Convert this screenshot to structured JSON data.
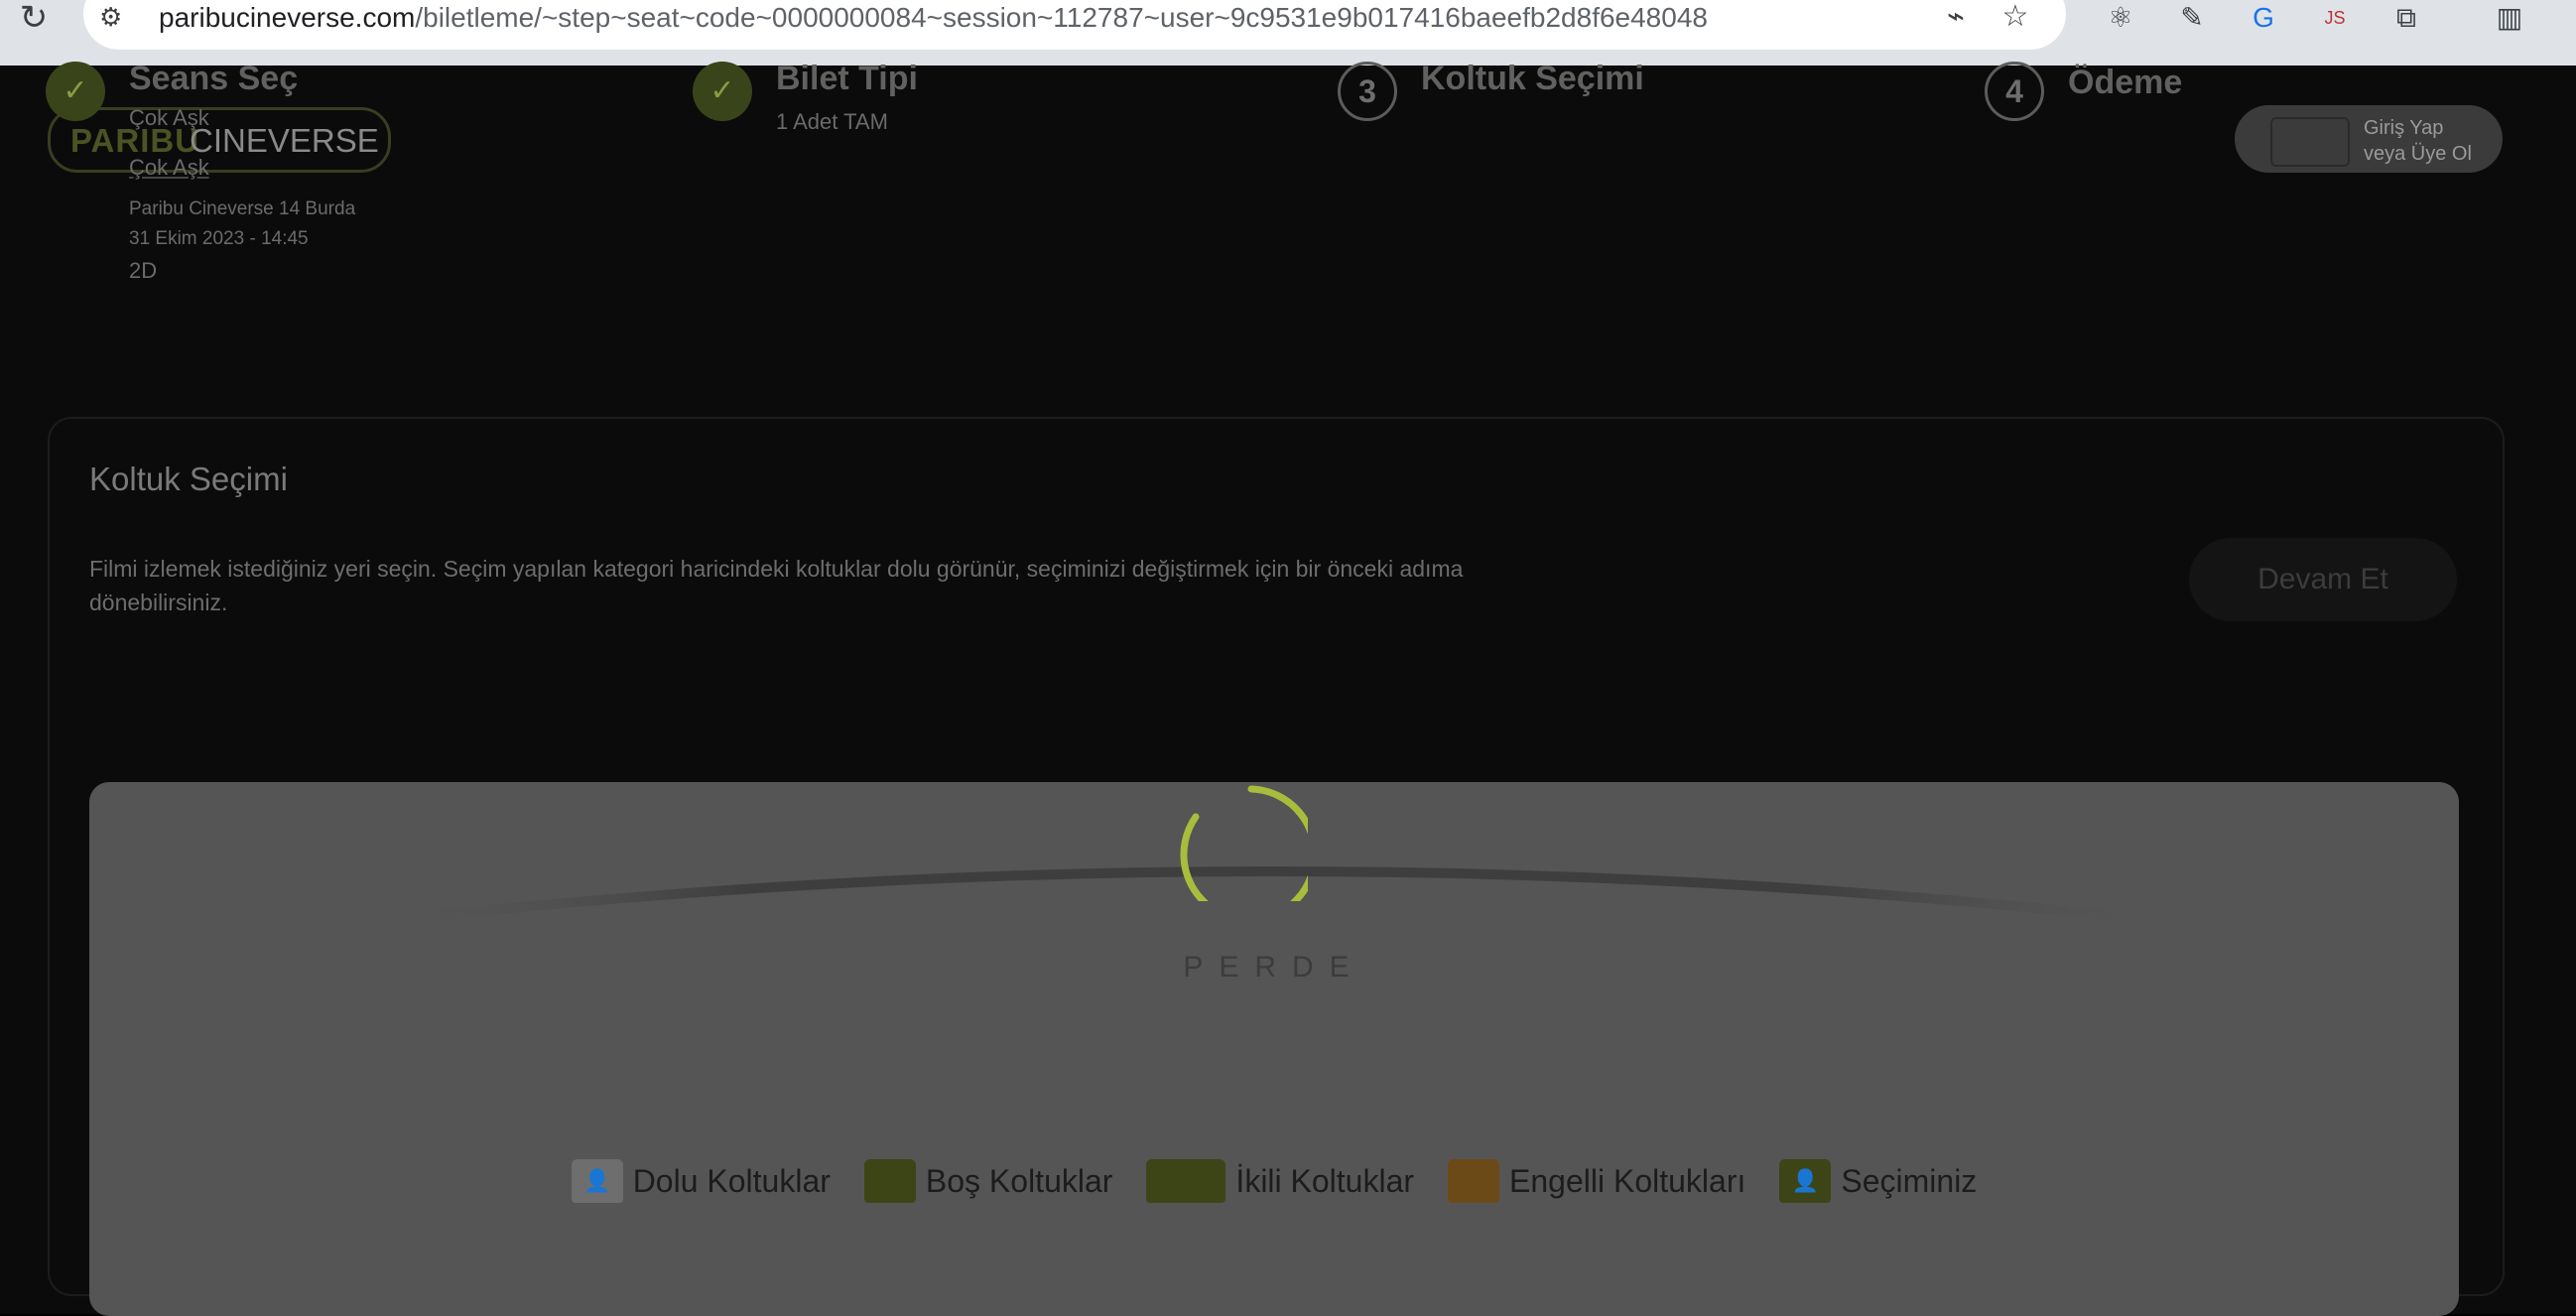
{
  "browser": {
    "url_domain": "paribucineverse.com",
    "url_path": "/biletleme/~step~seat~code~0000000084~session~112787~user~9c9531e9b017416baeefb2d8f6e48048",
    "extensions": [
      "react-devtools-icon",
      "eyedropper-icon",
      "translate-icon",
      "js-icon",
      "puzzle-icon",
      "sidebar-icon"
    ]
  },
  "header": {
    "logo_part1": "PARIBU",
    "logo_part2": "CINEVERSE",
    "login_line1": "Giriş Yap",
    "login_line2": "veya Üye Ol"
  },
  "steps": [
    {
      "number": "1",
      "title": "Seans Seç",
      "subtitle": "Çok Aşk",
      "done": true
    },
    {
      "number": "2",
      "title": "Bilet Tipi",
      "subtitle": "1 Adet TAM",
      "done": true
    },
    {
      "number": "3",
      "title": "Koltuk Seçimi",
      "subtitle": "",
      "done": false
    },
    {
      "number": "4",
      "title": "Ödeme",
      "subtitle": "",
      "done": false
    }
  ],
  "session": {
    "movie": "Çok Aşk",
    "cinema": "Paribu Cineverse 14 Burda",
    "datetime": "31 Ekim 2023 - 14:45",
    "format": "2D"
  },
  "seat_selection": {
    "title": "Koltuk Seçimi",
    "description": "Filmi izlemek istediğiniz yeri seçin. Seçim yapılan kategori haricindeki koltuklar dolu görünür, seçiminizi değiştirmek için bir önceki adıma dönebilirsiniz.",
    "continue_label": "Devam Et",
    "screen_label": "PERDE"
  },
  "legend": [
    {
      "label": "Dolu Koltuklar",
      "color": "#6e6e6e",
      "icon": "person"
    },
    {
      "label": "Boş Koltuklar",
      "color": "#3d4517",
      "icon": ""
    },
    {
      "label": "İkili Koltuklar",
      "color": "#3d4517",
      "icon": "",
      "wide": true
    },
    {
      "label": "Engelli Koltukları",
      "color": "#6b4a18",
      "icon": ""
    },
    {
      "label": "Seçiminiz",
      "color": "#3d4517",
      "icon": "person"
    }
  ],
  "colors": {
    "accent": "#a9bd3c",
    "overlay_bg": "#0b0b0b",
    "seatmap_bg": "#555555"
  }
}
